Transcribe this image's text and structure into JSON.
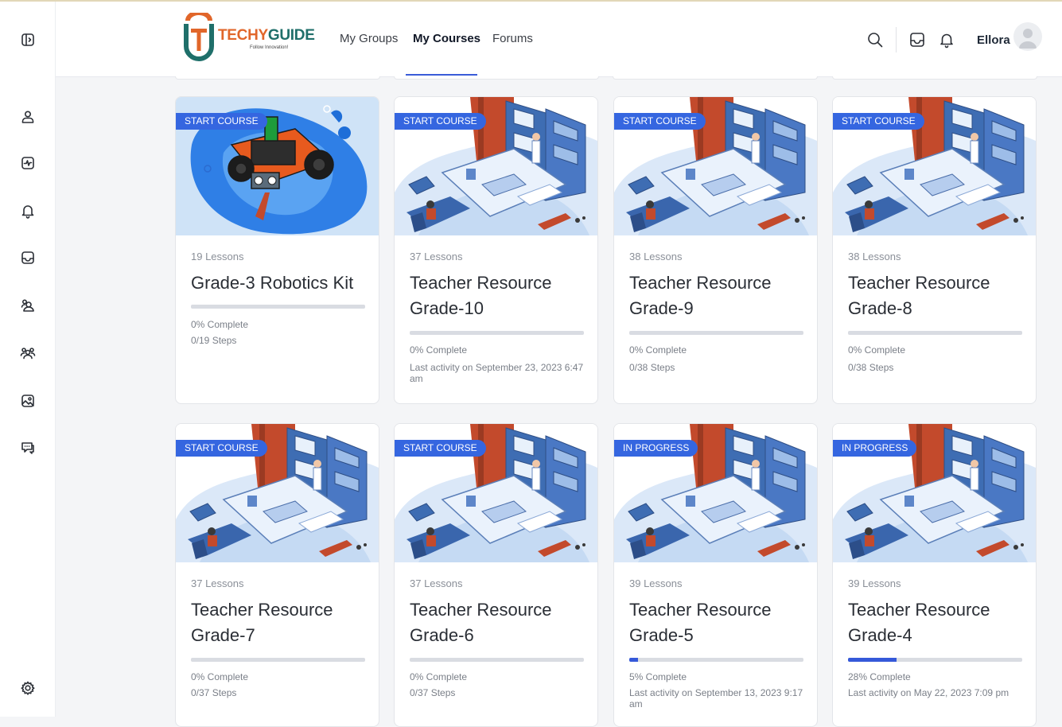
{
  "sidebar": {
    "icons": [
      "panel-toggle-icon",
      "user-icon",
      "activity-icon",
      "bell-icon",
      "inbox-icon",
      "users-icon",
      "group-icon",
      "photos-icon",
      "messages-icon",
      "settings-icon"
    ]
  },
  "header": {
    "logo": {
      "brand_part1": "TECHY",
      "brand_part2": "GUIDE",
      "tagline": "Follow Innovation!"
    },
    "nav": [
      {
        "label": "My Groups",
        "active": false
      },
      {
        "label": "My Courses",
        "active": true
      },
      {
        "label": "Forums",
        "active": false
      }
    ],
    "username": "Ellora",
    "icons": [
      "search-icon",
      "inbox-icon",
      "bell-icon"
    ]
  },
  "courses": [
    {
      "badge": "START COURSE",
      "lessons": "19 Lessons",
      "title": "Grade-3 Robotics Kit",
      "progress": 0,
      "complete": "0% Complete",
      "meta": "0/19 Steps",
      "image": "robotics"
    },
    {
      "badge": "START COURSE",
      "lessons": "37 Lessons",
      "title": "Teacher Resource Grade-10",
      "progress": 0,
      "complete": "0% Complete",
      "meta": "Last activity on September 23, 2023 6:47 am",
      "image": "teacher"
    },
    {
      "badge": "START COURSE",
      "lessons": "38 Lessons",
      "title": "Teacher Resource Grade-9",
      "progress": 0,
      "complete": "0% Complete",
      "meta": "0/38 Steps",
      "image": "teacher"
    },
    {
      "badge": "START COURSE",
      "lessons": "38 Lessons",
      "title": "Teacher Resource Grade-8",
      "progress": 0,
      "complete": "0% Complete",
      "meta": "0/38 Steps",
      "image": "teacher"
    },
    {
      "badge": "START COURSE",
      "lessons": "37 Lessons",
      "title": "Teacher Resource Grade-7",
      "progress": 0,
      "complete": "0% Complete",
      "meta": "0/37 Steps",
      "image": "teacher"
    },
    {
      "badge": "START COURSE",
      "lessons": "37 Lessons",
      "title": "Teacher Resource Grade-6",
      "progress": 0,
      "complete": "0% Complete",
      "meta": "0/37 Steps",
      "image": "teacher"
    },
    {
      "badge": "IN PROGRESS",
      "lessons": "39 Lessons",
      "title": "Teacher Resource Grade-5",
      "progress": 5,
      "complete": "5% Complete",
      "meta": "Last activity on September 13, 2023 9:17 am",
      "image": "teacher"
    },
    {
      "badge": "IN PROGRESS",
      "lessons": "39 Lessons",
      "title": "Teacher Resource Grade-4",
      "progress": 28,
      "complete": "28% Complete",
      "meta": "Last activity on May 22, 2023 7:09 pm",
      "image": "teacher"
    }
  ],
  "colors": {
    "accent": "#3566e0",
    "progress": "#3559d9",
    "track": "#d9dce2"
  }
}
